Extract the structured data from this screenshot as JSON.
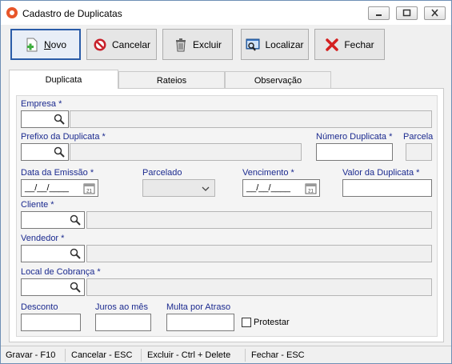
{
  "window": {
    "title": "Cadastro de Duplicatas"
  },
  "toolbar": {
    "novo_pre": "",
    "novo_mnemonic": "N",
    "novo_post": "ovo",
    "cancelar": "Cancelar",
    "excluir": "Excluir",
    "localizar": "Localizar",
    "fechar": "Fechar"
  },
  "tabs": [
    {
      "label": "Duplicata",
      "active": true
    },
    {
      "label": "Rateios",
      "active": false
    },
    {
      "label": "Observação",
      "active": false
    }
  ],
  "fields": {
    "empresa": "Empresa *",
    "prefixo": "Prefixo da Duplicata *",
    "numero": "Número Duplicata *",
    "parcela": "Parcela",
    "data_emissao": "Data da Emissão *",
    "data_emissao_value": "__/__/____",
    "parcelado": "Parcelado",
    "vencimento": "Vencimento *",
    "vencimento_value": "__/__/____",
    "valor": "Valor da Duplicata *",
    "cliente": "Cliente *",
    "vendedor": "Vendedor *",
    "local_cobranca": "Local de Cobrança *",
    "desconto": "Desconto",
    "juros": "Juros ao mês",
    "multa": "Multa por Atraso",
    "protestar": "Protestar"
  },
  "statusbar": {
    "gravar": "Gravar - F10",
    "cancelar": "Cancelar - ESC",
    "excluir": "Excluir - Ctrl + Delete",
    "fechar": "Fechar - ESC"
  },
  "colors": {
    "label": "#1b2a8f",
    "accent": "#2a5ca8",
    "close_red": "#d42020"
  }
}
